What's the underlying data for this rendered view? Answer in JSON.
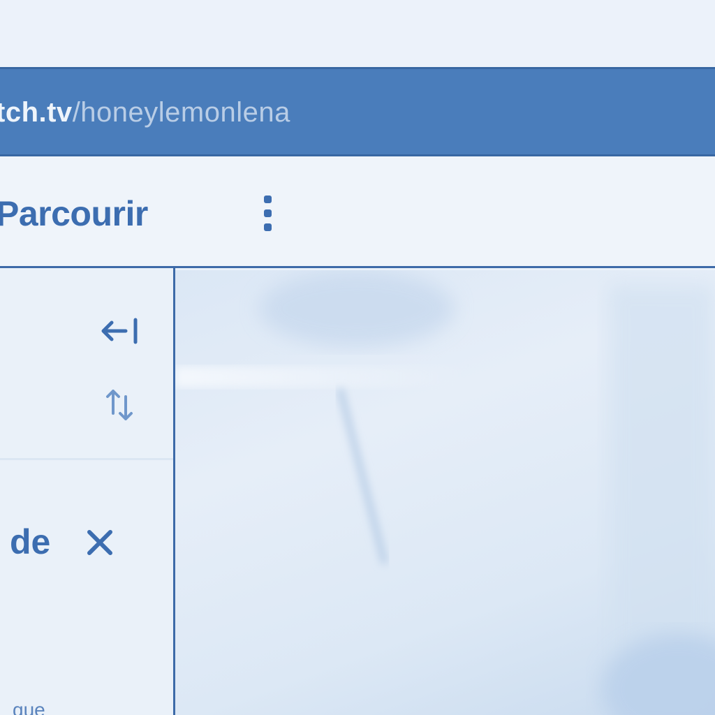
{
  "browser": {
    "url_host": "tch.tv",
    "url_path": "/honeylemonlena"
  },
  "nav": {
    "browse_label": "Parcourir",
    "more_icon": "vertical-ellipsis-icon"
  },
  "sidebar": {
    "collapse_icon": "collapse-left-icon",
    "sort_icon": "sort-arrows-icon",
    "popup": {
      "title": "de",
      "close_icon": "close-icon",
      "body_fragment": "que"
    }
  },
  "stream": {
    "description_icon": "video-player"
  },
  "colors": {
    "accent": "#3c6db0",
    "address_bar": "#4a7dbb",
    "background": "#eaf1f9"
  }
}
